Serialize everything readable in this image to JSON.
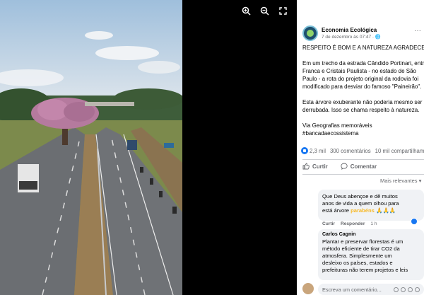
{
  "viewer": {
    "zoom_in_icon": "zoom-in-icon",
    "zoom_out_icon": "zoom-out-icon",
    "fullscreen_icon": "fullscreen-icon"
  },
  "post": {
    "author": "Economia Ecológica",
    "date": "7 de dezembro às 07:47 · ",
    "more_label": "···",
    "headline": "RESPEITO É BOM E A NATUREZA AGRADECE",
    "body_lines": [
      "Em um trecho da estrada Cândido Portinari, entre",
      "Franca e Cristais Paulista - no estado de São",
      "Paulo - a rota do projeto original da rodovia foi",
      "modificado para desviar do famoso \"Paineirão\"."
    ],
    "body2_lines": [
      "Esta árvore exuberante não poderia mesmo ser",
      "derrubada. Isso se chama respeito à natureza."
    ],
    "via_label": "Via Geografias memoráveis",
    "hashtag": "#bancadaecossistema"
  },
  "stats": {
    "reactions": "2,3 mil",
    "comments": "300 comentários",
    "shares": "10 mil compartilhamentos"
  },
  "actions": {
    "like": "Curtir",
    "comment": "Comentar"
  },
  "filter": {
    "label": "Mais relevantes"
  },
  "comments": [
    {
      "lines": [
        "Que Deus abençoe e dê muitos",
        "anos de vida a quem olhou para",
        "está árvore "
      ],
      "highlight": "parabéns 🙏🙏🙏",
      "like_label": "Curtir",
      "reply_label": "Responder",
      "time": "1 h"
    },
    {
      "author": "Carlos Cagnin",
      "lines": [
        "Plantar e preservar florestas é um",
        "método eficiente de tirar CO2 da",
        "atmosfera. Simplesmente um",
        "desleixo os países, estados e",
        "prefeituras não terem projetos e leis"
      ]
    }
  ],
  "composer": {
    "placeholder": "Escreva um comentário..."
  },
  "colors": {
    "accent": "#1877f2",
    "text": "#050505",
    "secondary": "#65676b",
    "bubble": "#f0f2f5"
  }
}
